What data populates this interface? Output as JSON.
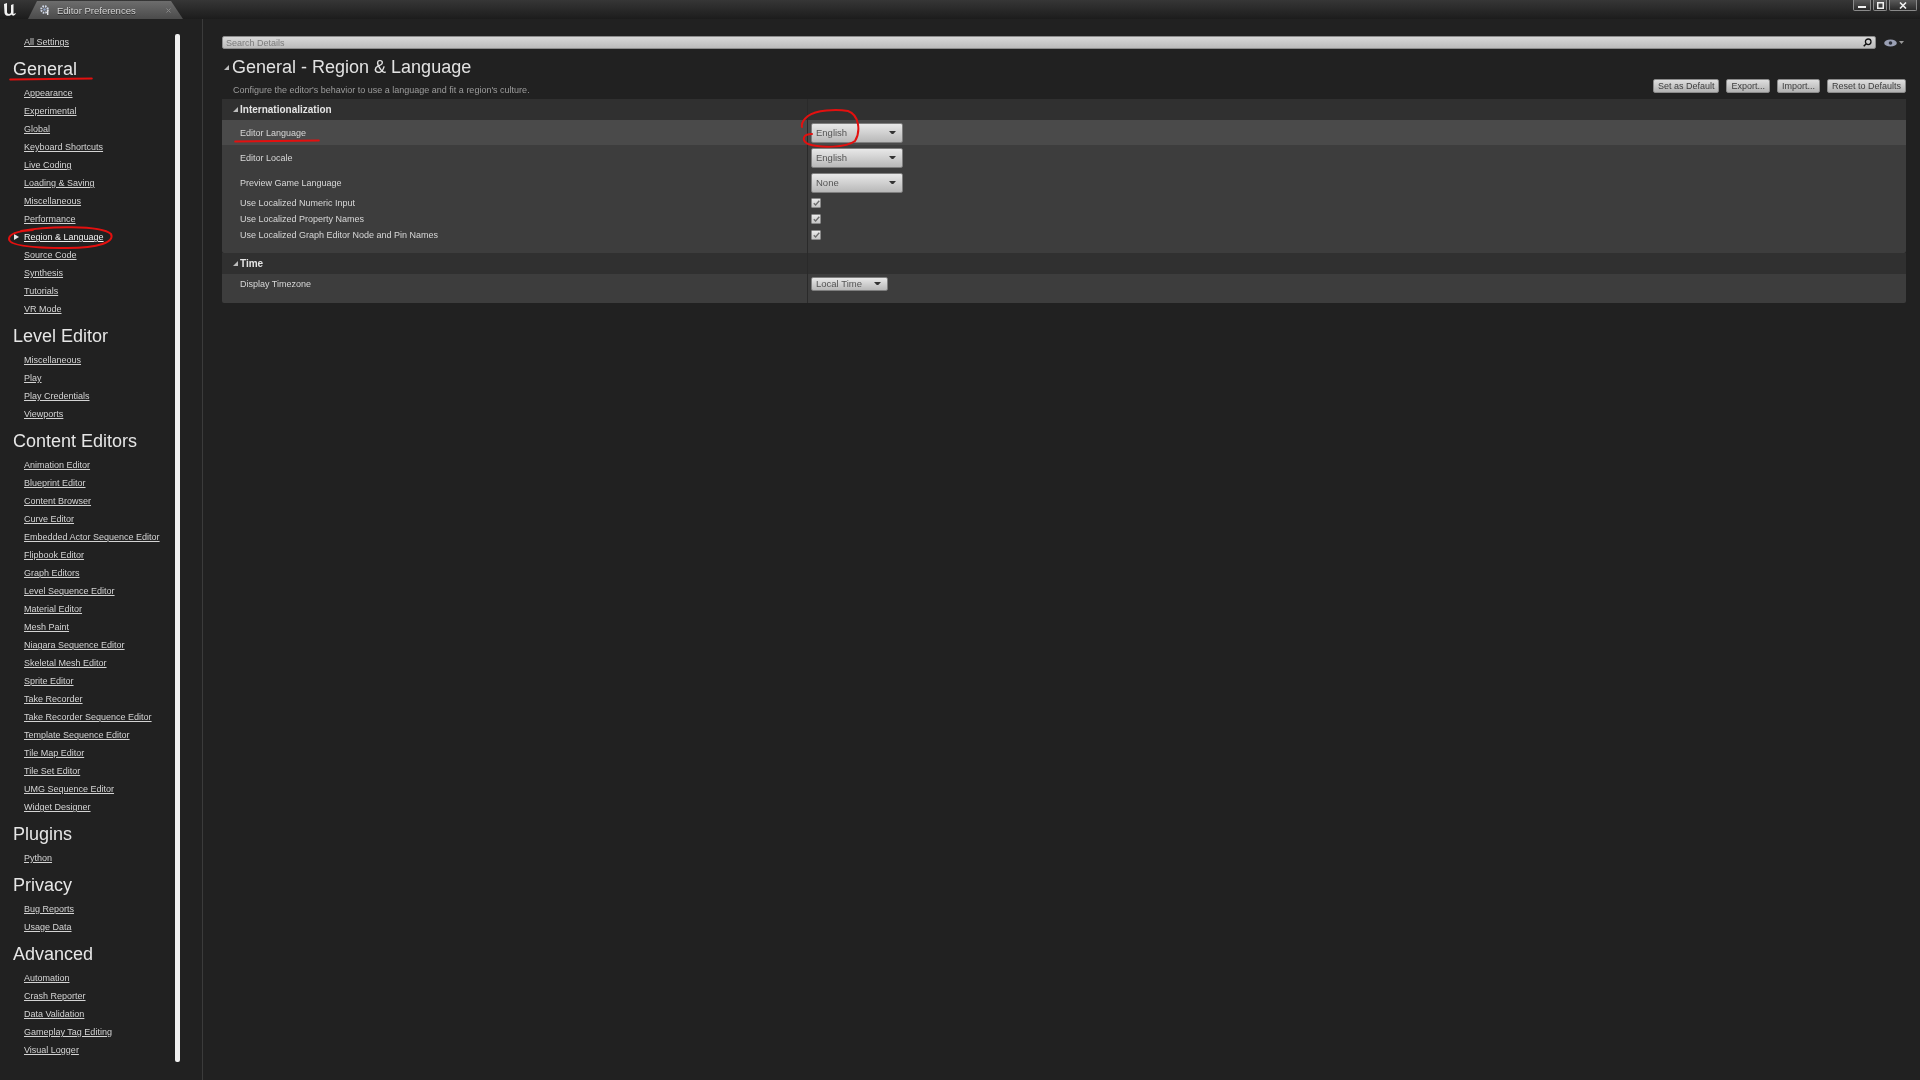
{
  "tab": {
    "title": "Editor Preferences"
  },
  "sidebar": {
    "all_settings": "All Settings",
    "groups": [
      {
        "title": "General",
        "underlined": true,
        "items": [
          {
            "label": "Appearance",
            "selected": false,
            "circled": false
          },
          {
            "label": "Experimental",
            "selected": false,
            "circled": false
          },
          {
            "label": "Global",
            "selected": false,
            "circled": false
          },
          {
            "label": "Keyboard Shortcuts",
            "selected": false,
            "circled": false
          },
          {
            "label": "Live Coding",
            "selected": false,
            "circled": false
          },
          {
            "label": "Loading & Saving",
            "selected": false,
            "circled": false
          },
          {
            "label": "Miscellaneous",
            "selected": false,
            "circled": false
          },
          {
            "label": "Performance",
            "selected": false,
            "circled": false
          },
          {
            "label": "Region & Language",
            "selected": true,
            "circled": true
          },
          {
            "label": "Source Code",
            "selected": false,
            "circled": false
          },
          {
            "label": "Synthesis",
            "selected": false,
            "circled": false
          },
          {
            "label": "Tutorials",
            "selected": false,
            "circled": false
          },
          {
            "label": "VR Mode",
            "selected": false,
            "circled": false
          }
        ]
      },
      {
        "title": "Level Editor",
        "underlined": false,
        "items": [
          {
            "label": "Miscellaneous",
            "selected": false,
            "circled": false
          },
          {
            "label": "Play",
            "selected": false,
            "circled": false
          },
          {
            "label": "Play Credentials",
            "selected": false,
            "circled": false
          },
          {
            "label": "Viewports",
            "selected": false,
            "circled": false
          }
        ]
      },
      {
        "title": "Content Editors",
        "underlined": false,
        "items": [
          {
            "label": "Animation Editor",
            "selected": false,
            "circled": false
          },
          {
            "label": "Blueprint Editor",
            "selected": false,
            "circled": false
          },
          {
            "label": "Content Browser",
            "selected": false,
            "circled": false
          },
          {
            "label": "Curve Editor",
            "selected": false,
            "circled": false
          },
          {
            "label": "Embedded Actor Sequence Editor",
            "selected": false,
            "circled": false
          },
          {
            "label": "Flipbook Editor",
            "selected": false,
            "circled": false
          },
          {
            "label": "Graph Editors",
            "selected": false,
            "circled": false
          },
          {
            "label": "Level Sequence Editor",
            "selected": false,
            "circled": false
          },
          {
            "label": "Material Editor",
            "selected": false,
            "circled": false
          },
          {
            "label": "Mesh Paint",
            "selected": false,
            "circled": false
          },
          {
            "label": "Niagara Sequence Editor",
            "selected": false,
            "circled": false
          },
          {
            "label": "Skeletal Mesh Editor",
            "selected": false,
            "circled": false
          },
          {
            "label": "Sprite Editor",
            "selected": false,
            "circled": false
          },
          {
            "label": "Take Recorder",
            "selected": false,
            "circled": false
          },
          {
            "label": "Take Recorder Sequence Editor",
            "selected": false,
            "circled": false
          },
          {
            "label": "Template Sequence Editor",
            "selected": false,
            "circled": false
          },
          {
            "label": "Tile Map Editor",
            "selected": false,
            "circled": false
          },
          {
            "label": "Tile Set Editor",
            "selected": false,
            "circled": false
          },
          {
            "label": "UMG Sequence Editor",
            "selected": false,
            "circled": false
          },
          {
            "label": "Widget Designer",
            "selected": false,
            "circled": false
          }
        ]
      },
      {
        "title": "Plugins",
        "underlined": false,
        "items": [
          {
            "label": "Python",
            "selected": false,
            "circled": false
          }
        ]
      },
      {
        "title": "Privacy",
        "underlined": false,
        "items": [
          {
            "label": "Bug Reports",
            "selected": false,
            "circled": false
          },
          {
            "label": "Usage Data",
            "selected": false,
            "circled": false
          }
        ]
      },
      {
        "title": "Advanced",
        "underlined": false,
        "items": [
          {
            "label": "Automation",
            "selected": false,
            "circled": false
          },
          {
            "label": "Crash Reporter",
            "selected": false,
            "circled": false
          },
          {
            "label": "Data Validation",
            "selected": false,
            "circled": false
          },
          {
            "label": "Gameplay Tag Editing",
            "selected": false,
            "circled": false
          },
          {
            "label": "Visual Logger",
            "selected": false,
            "circled": false
          }
        ]
      }
    ]
  },
  "search": {
    "placeholder": "Search Details"
  },
  "header": {
    "title": "General - Region & Language",
    "expanded": true,
    "description": "Configure the editor's behavior to use a language and fit a region's culture.",
    "buttons": [
      "Set as Default",
      "Export...",
      "Import...",
      "Reset to Defaults"
    ]
  },
  "sections": [
    {
      "title": "Internationalization",
      "expanded": true,
      "rows": [
        {
          "label": "Editor Language",
          "kind": "dropdown",
          "value": "English",
          "selected": true,
          "label_underlined": true,
          "value_circled": true
        },
        {
          "label": "Editor Locale",
          "kind": "dropdown",
          "value": "English",
          "selected": false,
          "label_underlined": false,
          "value_circled": false
        },
        {
          "label": "Preview Game Language",
          "kind": "dropdown",
          "value": "None",
          "selected": false,
          "label_underlined": false,
          "value_circled": false
        },
        {
          "label": "Use Localized Numeric Input",
          "kind": "checkbox",
          "checked": true,
          "selected": false,
          "label_underlined": false,
          "value_circled": false
        },
        {
          "label": "Use Localized Property Names",
          "kind": "checkbox",
          "checked": true,
          "selected": false,
          "label_underlined": false,
          "value_circled": false
        },
        {
          "label": "Use Localized Graph Editor Node and Pin Names",
          "kind": "checkbox",
          "checked": true,
          "selected": false,
          "label_underlined": false,
          "value_circled": false
        }
      ]
    },
    {
      "title": "Time",
      "expanded": true,
      "rows": [
        {
          "label": "Display Timezone",
          "kind": "small_dropdown",
          "value": "Local Time",
          "selected": false,
          "label_underlined": false,
          "value_circled": false
        }
      ]
    }
  ]
}
